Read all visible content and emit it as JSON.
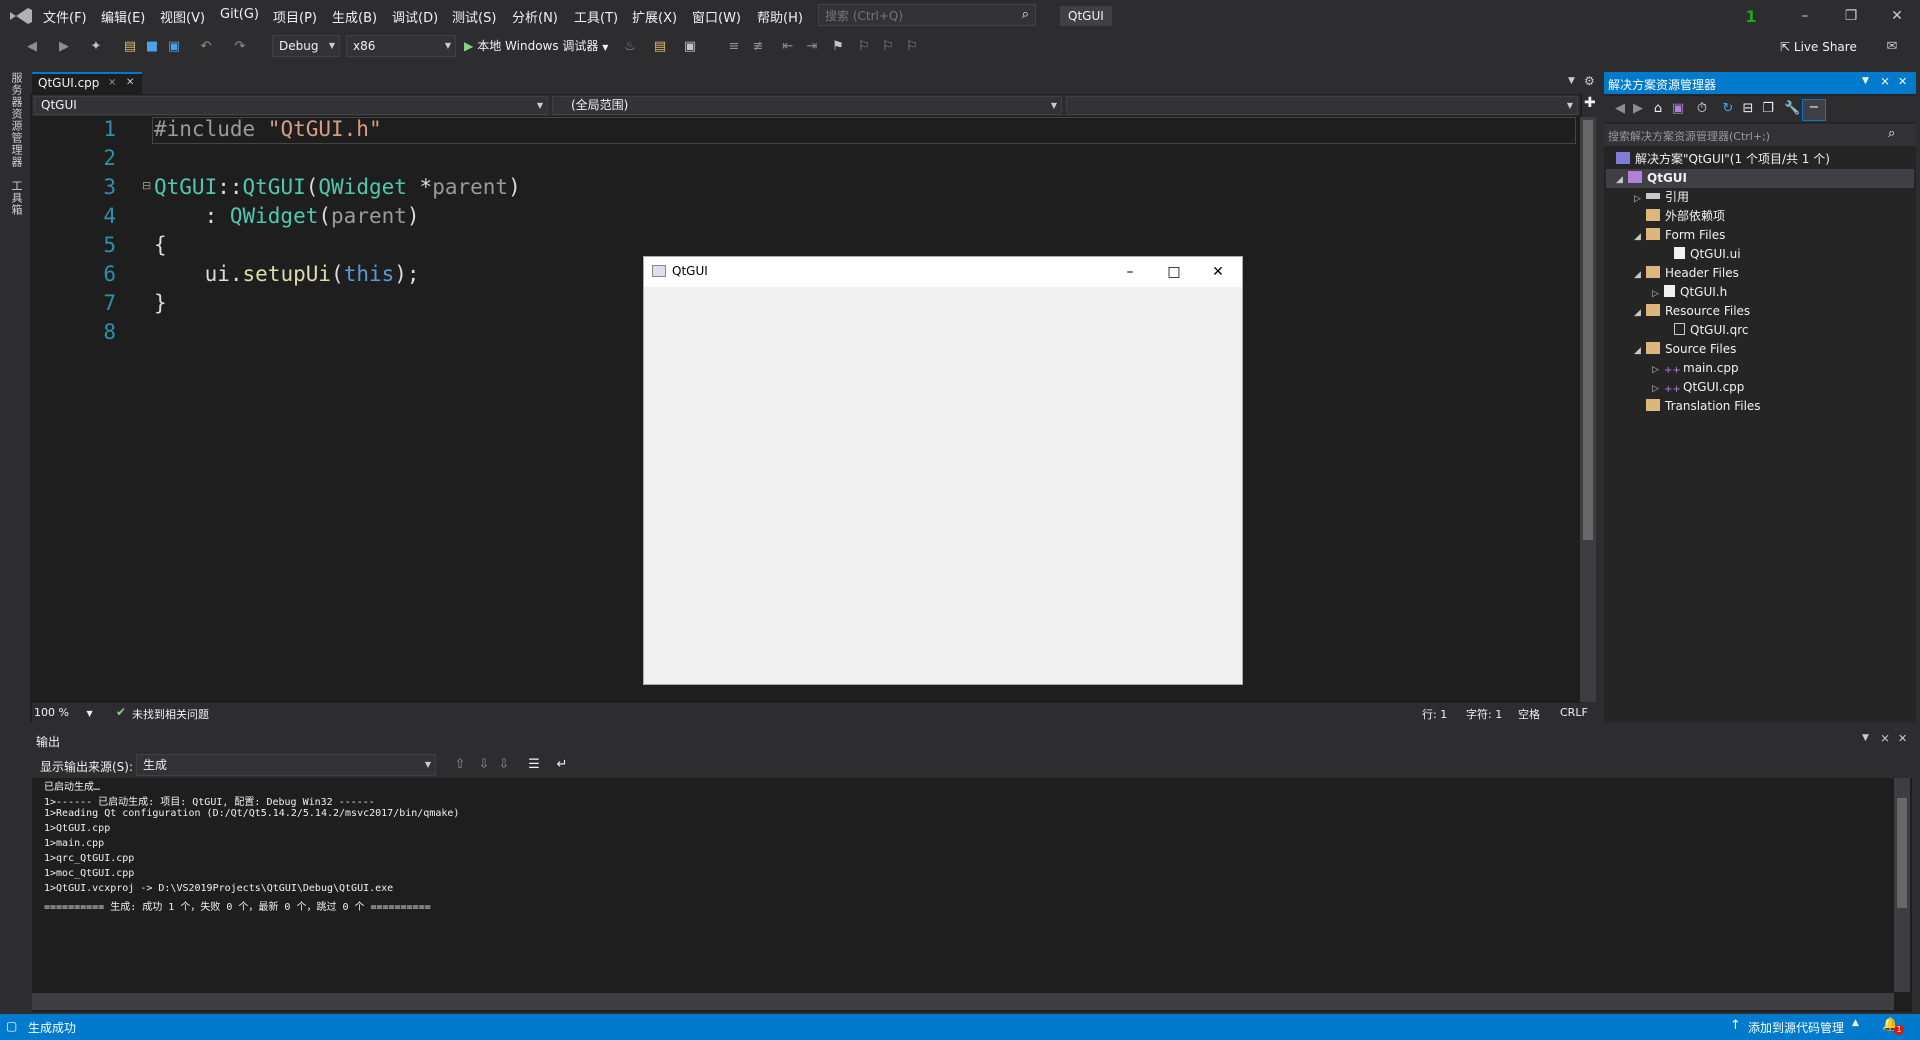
{
  "menubar": {
    "items": [
      "文件(F)",
      "编辑(E)",
      "视图(V)",
      "Git(G)",
      "项目(P)",
      "生成(B)",
      "调试(D)",
      "测试(S)",
      "分析(N)",
      "工具(T)",
      "扩展(X)",
      "窗口(W)",
      "帮助(H)"
    ],
    "search_placeholder": "搜索 (Ctrl+Q)",
    "solution_name": "QtGUI",
    "notification_count": "1"
  },
  "toolbar": {
    "config": "Debug",
    "platform": "x86",
    "run_label": "本地 Windows 调试器",
    "live_share": "Live Share"
  },
  "left_rail": {
    "tab1": "服务器资源管理器",
    "tab2": "工具箱"
  },
  "editor": {
    "tab_name": "QtGUI.cpp",
    "nav_project": "QtGUI",
    "nav_scope": "(全局范围)",
    "line_numbers": [
      "1",
      "2",
      "3",
      "4",
      "5",
      "6",
      "7",
      "8"
    ],
    "code": {
      "l1_pp": "#include ",
      "l1_str": "\"QtGUI.h\"",
      "l3_a": "QtGUI",
      "l3_b": "::",
      "l3_c": "QtGUI",
      "l3_d": "(",
      "l3_e": "QWidget",
      "l3_f": " *",
      "l3_g": "parent",
      "l3_h": ")",
      "l4_a": "    : ",
      "l4_b": "QWidget",
      "l4_c": "(",
      "l4_d": "parent",
      "l4_e": ")",
      "l5": "{",
      "l6_a": "    ui.",
      "l6_b": "setupUi",
      "l6_c": "(",
      "l6_d": "this",
      "l6_e": ");",
      "l7": "}"
    },
    "status": {
      "zoom": "100 %",
      "issues": "未找到相关问题",
      "line": "行: 1",
      "char": "字符: 1",
      "spaces": "空格",
      "eol": "CRLF"
    }
  },
  "qt_window": {
    "title": "QtGUI"
  },
  "output": {
    "title": "输出",
    "source_label": "显示输出来源(S):",
    "source_value": "生成",
    "lines": [
      "已启动生成…",
      "1>------ 已启动生成: 项目: QtGUI, 配置: Debug Win32 ------",
      "1>Reading Qt configuration (D:/Qt/Qt5.14.2/5.14.2/msvc2017/bin/qmake)",
      "1>QtGUI.cpp",
      "1>main.cpp",
      "1>qrc_QtGUI.cpp",
      "1>moc_QtGUI.cpp",
      "1>QtGUI.vcxproj -> D:\\VS2019Projects\\QtGUI\\Debug\\QtGUI.exe",
      "========== 生成: 成功 1 个，失败 0 个，最新 0 个，跳过 0 个 =========="
    ]
  },
  "solution_explorer": {
    "title": "解决方案资源管理器",
    "search_placeholder": "搜索解决方案资源管理器(Ctrl+;)",
    "solution_label": "解决方案\"QtGUI\"(1 个项目/共 1 个)",
    "project": "QtGUI",
    "references": "引用",
    "external_deps": "外部依赖项",
    "form_files": "Form Files",
    "form_ui": "QtGUI.ui",
    "header_files": "Header Files",
    "header_h": "QtGUI.h",
    "resource_files": "Resource Files",
    "resource_qrc": "QtGUI.qrc",
    "source_files": "Source Files",
    "main_cpp": "main.cpp",
    "qtgui_cpp": "QtGUI.cpp",
    "translation_files": "Translation Files"
  },
  "statusbar": {
    "build_status": "生成成功",
    "source_control": "添加到源代码管理",
    "notifications": "1"
  }
}
